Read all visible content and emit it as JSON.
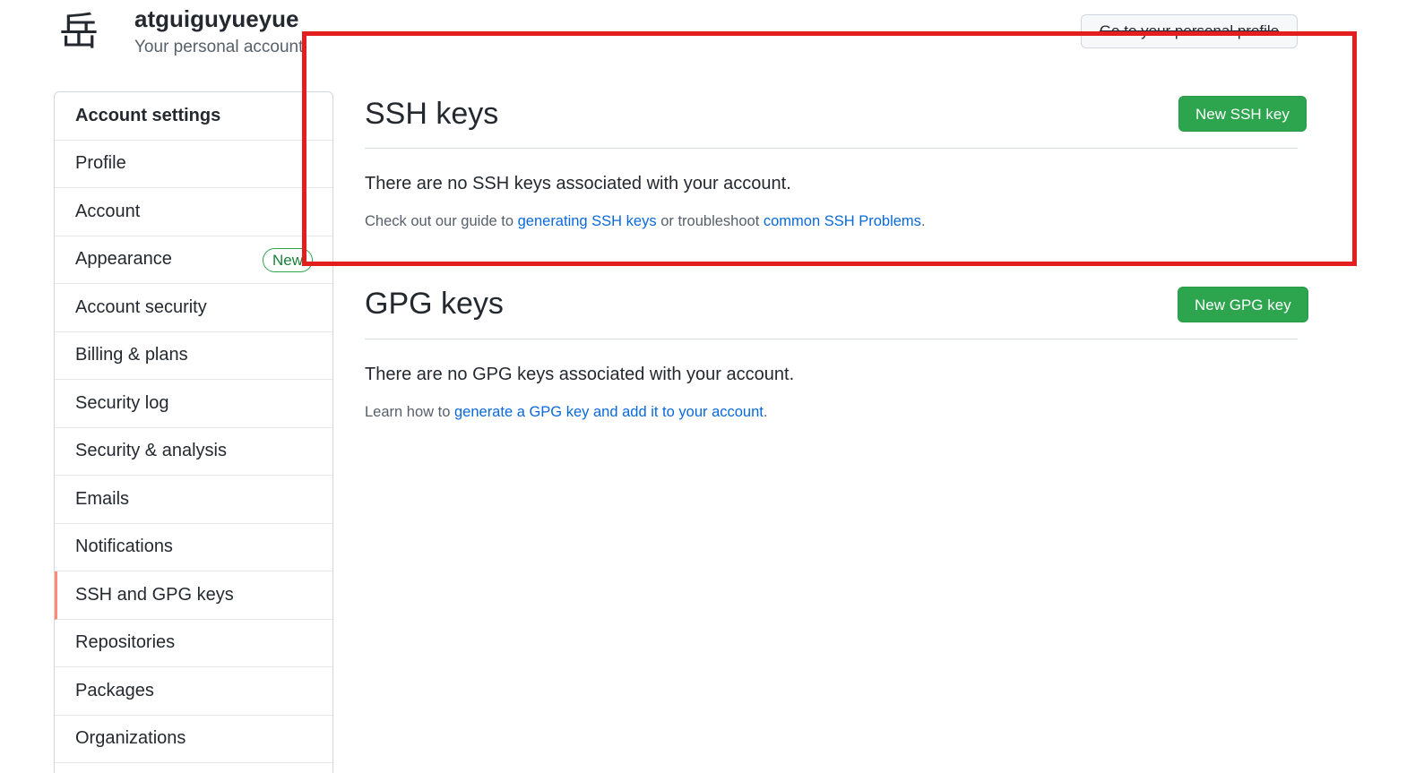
{
  "header": {
    "avatar_glyph": "岳",
    "username": "atguiguyueyue",
    "subtitle": "Your personal account",
    "profile_button": "Go to your personal profile"
  },
  "sidebar": {
    "items": [
      {
        "label": "Account settings"
      },
      {
        "label": "Profile"
      },
      {
        "label": "Account"
      },
      {
        "label": "Appearance",
        "badge": "New"
      },
      {
        "label": "Account security"
      },
      {
        "label": "Billing & plans"
      },
      {
        "label": "Security log"
      },
      {
        "label": "Security & analysis"
      },
      {
        "label": "Emails"
      },
      {
        "label": "Notifications"
      },
      {
        "label": "SSH and GPG keys"
      },
      {
        "label": "Repositories"
      },
      {
        "label": "Packages"
      },
      {
        "label": "Organizations"
      }
    ]
  },
  "ssh": {
    "title": "SSH keys",
    "button": "New SSH key",
    "empty_message": "There are no SSH keys associated with your account.",
    "note_prefix": "Check out our guide to ",
    "note_link1": "generating SSH keys",
    "note_middle": " or troubleshoot ",
    "note_link2": "common SSH Problems",
    "note_suffix": "."
  },
  "gpg": {
    "title": "GPG keys",
    "button": "New GPG key",
    "empty_message": "There are no GPG keys associated with your account.",
    "note_prefix": "Learn how to ",
    "note_link": "generate a GPG key and add it to your account",
    "note_suffix": "."
  },
  "colors": {
    "accent_green": "#2da44e",
    "link_blue": "#0969da",
    "active_marker": "#fd8c73",
    "highlight_red": "#e21e1e"
  }
}
